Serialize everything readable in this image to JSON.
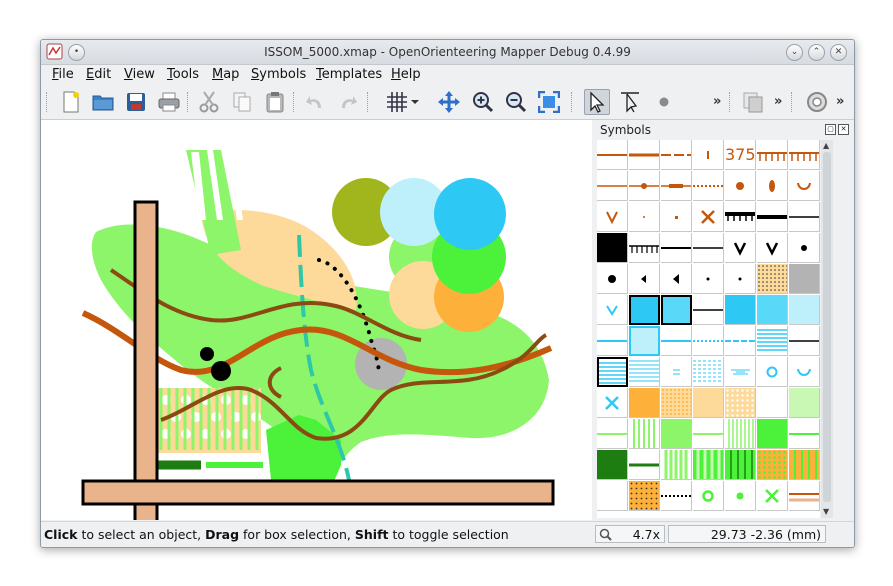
{
  "window": {
    "title": "ISSOM_5000.xmap - OpenOrienteering Mapper Debug 0.4.99"
  },
  "menubar": {
    "items": [
      {
        "label": "File",
        "accel": "F",
        "rest": "ile"
      },
      {
        "label": "Edit",
        "accel": "E",
        "rest": "dit"
      },
      {
        "label": "View",
        "accel": "V",
        "rest": "iew"
      },
      {
        "label": "Tools",
        "accel": "T",
        "rest": "ools"
      },
      {
        "label": "Map",
        "accel": "M",
        "rest": "ap"
      },
      {
        "label": "Symbols",
        "accel": "S",
        "rest": "ymbols"
      },
      {
        "label": "Templates",
        "accel": "T",
        "rest": "emplates"
      },
      {
        "label": "Help",
        "accel": "H",
        "rest": "elp"
      }
    ]
  },
  "toolbar": {
    "tools": [
      "new-file-icon",
      "open-folder-icon",
      "save-icon",
      "print-icon",
      "cut-icon",
      "copy-icon",
      "paste-icon",
      "undo-icon",
      "redo-icon",
      "grid-icon",
      "pan-icon",
      "zoom-in-icon",
      "zoom-out-icon",
      "fullscreen-icon",
      "edit-objects-icon",
      "edit-lines-icon",
      "draw-point-icon"
    ],
    "overflow": "»"
  },
  "symbols_dock": {
    "title": "Symbols",
    "text_symbol_label": "375"
  },
  "statusbar": {
    "hint_click": "Click",
    "hint_click_rest": " to select an object, ",
    "hint_drag": "Drag",
    "hint_drag_rest": " for box selection, ",
    "hint_shift": "Shift",
    "hint_shift_rest": " to toggle selection",
    "zoom": "4.7x",
    "coordinates": "29.73 -2.36 (mm)"
  },
  "colors": {
    "contour_brown": "#c5570c",
    "dark_brown": "#8b4a12",
    "path_tan": "#e9b48c",
    "light_green": "#8cf56a",
    "bright_green": "#4cf23a",
    "dark_green": "#1e7d10",
    "water_blue": "#2ec8f5",
    "open_yellow": "#fdd99a",
    "olive": "#a1b61c",
    "light_blue": "#bdf0fa",
    "orange": "#fdb13a",
    "grey": "#b3b3b3"
  }
}
